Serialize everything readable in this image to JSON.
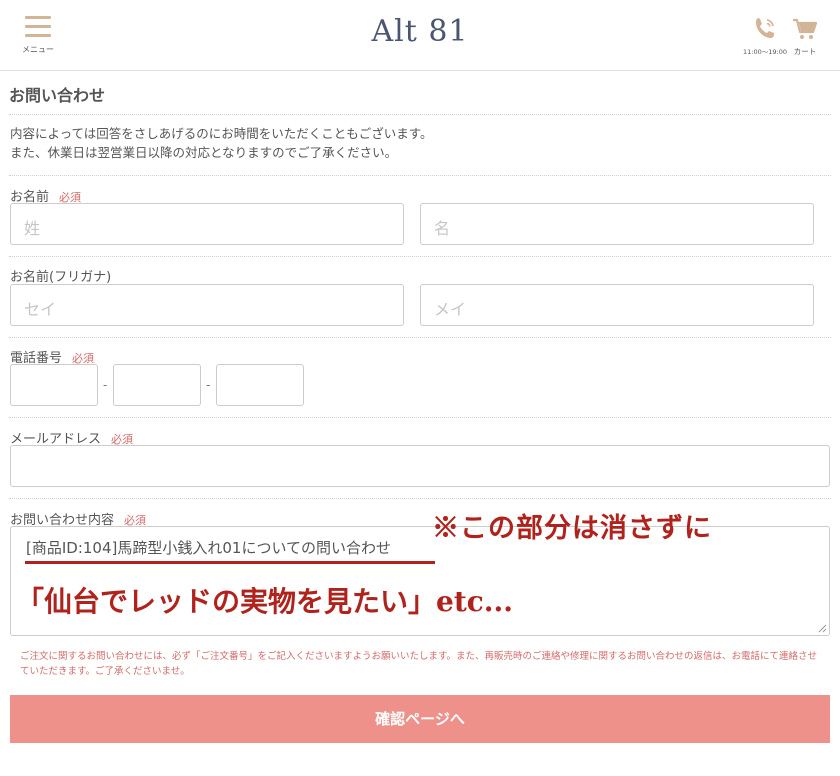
{
  "header": {
    "menu_label": "メニュー",
    "logo": "Alt 81",
    "tel_hours": "11:00〜19:00",
    "cart_label": "カート",
    "accent_color": "#d4b496"
  },
  "page": {
    "title": "お問い合わせ",
    "intro_line1": "内容によっては回答をさしあげるのにお時間をいただくこともございます。",
    "intro_line2": "また、休業日は翌営業日以降の対応となりますのでご了承ください。"
  },
  "form": {
    "name": {
      "label": "お名前",
      "required": "必須",
      "last_placeholder": "姓",
      "first_placeholder": "名"
    },
    "kana": {
      "label": "お名前(フリガナ)",
      "last_placeholder": "セイ",
      "first_placeholder": "メイ"
    },
    "tel": {
      "label": "電話番号",
      "required": "必須",
      "separator": "-"
    },
    "email": {
      "label": "メールアドレス",
      "required": "必須"
    },
    "inquiry": {
      "label": "お問い合わせ内容",
      "required": "必須",
      "value": "[商品ID:104]馬蹄型小銭入れ01についての問い合わせ"
    },
    "notice": "ご注文に関するお問い合わせには、必ず「ご注文番号」をご記入くださいますようお願いいたします。また、再販売時のご連絡や修理に関するお問い合わせの返信は、お電話にて連絡させていただきます。ご了承くださいませ。",
    "submit_label": "確認ページへ"
  },
  "annotations": {
    "note1": "※この部分は消さずに",
    "note2": "「仙台でレッドの実物を見たい」etc...",
    "color": "#b0231d"
  }
}
